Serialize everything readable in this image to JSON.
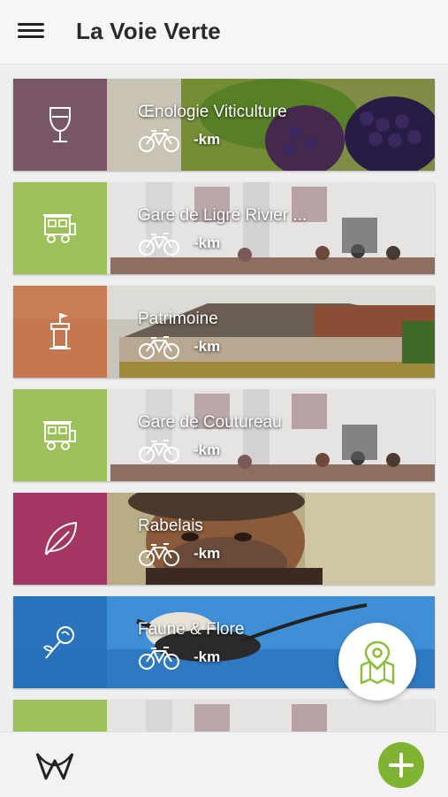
{
  "app": {
    "title": "La Voie Verte"
  },
  "items": [
    {
      "title": "Œnologie Viticulture",
      "distance": "-km",
      "icon": "wine-glass-icon",
      "color": "#7a4b6e"
    },
    {
      "title": "Gare de Ligré Rivier ...",
      "distance": "-km",
      "icon": "train-icon",
      "color": "#8fb940"
    },
    {
      "title": "Patrimoine",
      "distance": "-km",
      "icon": "tower-flag-icon",
      "color": "#c46a3a"
    },
    {
      "title": "Gare de Coutureau",
      "distance": "-km",
      "icon": "train-icon",
      "color": "#8fb940"
    },
    {
      "title": "Rabelais",
      "distance": "-km",
      "icon": "leaf-icon",
      "color": "#a0255f"
    },
    {
      "title": "Faune & Flore",
      "distance": "-km",
      "icon": "rose-icon",
      "color": "#2b74b8"
    },
    {
      "title": "",
      "distance": "",
      "icon": "",
      "color": "#8fb940"
    }
  ],
  "colors": {
    "accent": "#7fb332",
    "map_icon": "#8bbf3a"
  },
  "bottom": {
    "logo": "voie-verte-logo",
    "add": "plus-icon"
  }
}
